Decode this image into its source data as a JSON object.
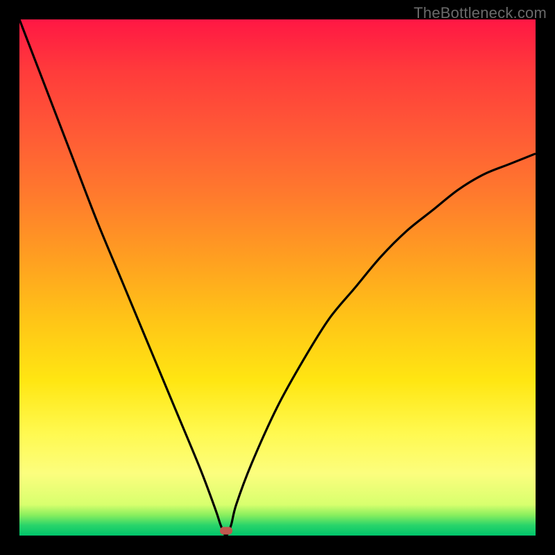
{
  "watermark": "TheBottleneck.com",
  "colors": {
    "frame": "#000000",
    "curve": "#000000",
    "marker": "#c0584f",
    "gradient_top": "#ff1744",
    "gradient_bottom": "#00c56b"
  },
  "chart_data": {
    "type": "line",
    "title": "",
    "xlabel": "",
    "ylabel": "",
    "xlim": [
      0,
      100
    ],
    "ylim": [
      0,
      100
    ],
    "grid": false,
    "legend": null,
    "series": [
      {
        "name": "bottleneck-curve",
        "x": [
          0,
          5,
          10,
          15,
          20,
          25,
          30,
          35,
          38,
          39,
          40,
          41,
          42,
          45,
          50,
          55,
          60,
          65,
          70,
          75,
          80,
          85,
          90,
          95,
          100
        ],
        "values": [
          100,
          87,
          74,
          61,
          49,
          37,
          25,
          13,
          5,
          2,
          0,
          2,
          6,
          14,
          25,
          34,
          42,
          48,
          54,
          59,
          63,
          67,
          70,
          72,
          74
        ]
      }
    ],
    "marker": {
      "x": 40,
      "y": 1
    },
    "annotations": []
  }
}
